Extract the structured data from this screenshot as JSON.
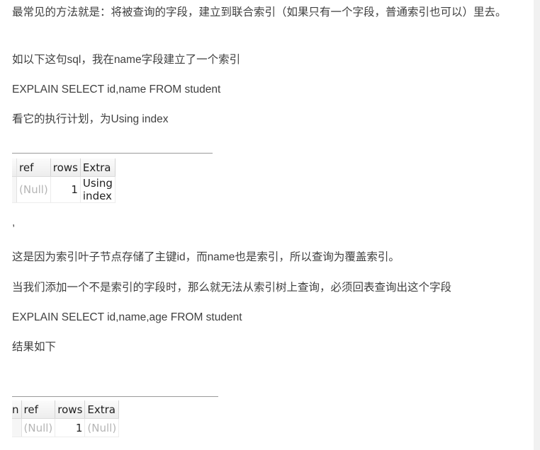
{
  "article": {
    "p1": "最常见的方法就是：将被查询的字段，建立到联合索引（如果只有一个字段，普通索引也可以）里去。",
    "p2": "如以下这句sql，我在name字段建立了一个索引",
    "p3": "EXPLAIN SELECT id,name FROM student",
    "p4": "看它的执行计划，为Using index",
    "p5": ",",
    "p6": "这是因为索引叶子节点存储了主键id，而name也是索引，所以查询为覆盖索引。",
    "p7": "当我们添加一个不是索引的字段时，那么就无法从索引树上查询，必须回表查询出这个字段",
    "p8": "EXPLAIN SELECT id,name,age FROM student",
    "p9": "结果如下"
  },
  "table1": {
    "headers": [
      "",
      "ref",
      "rows",
      "Extra"
    ],
    "row": [
      "",
      "(Null)",
      "1",
      "Using index"
    ]
  },
  "table2": {
    "headers": [
      "n",
      "ref",
      "rows",
      "Extra"
    ],
    "row": [
      "",
      "(Null)",
      "1",
      "(Null)"
    ]
  }
}
